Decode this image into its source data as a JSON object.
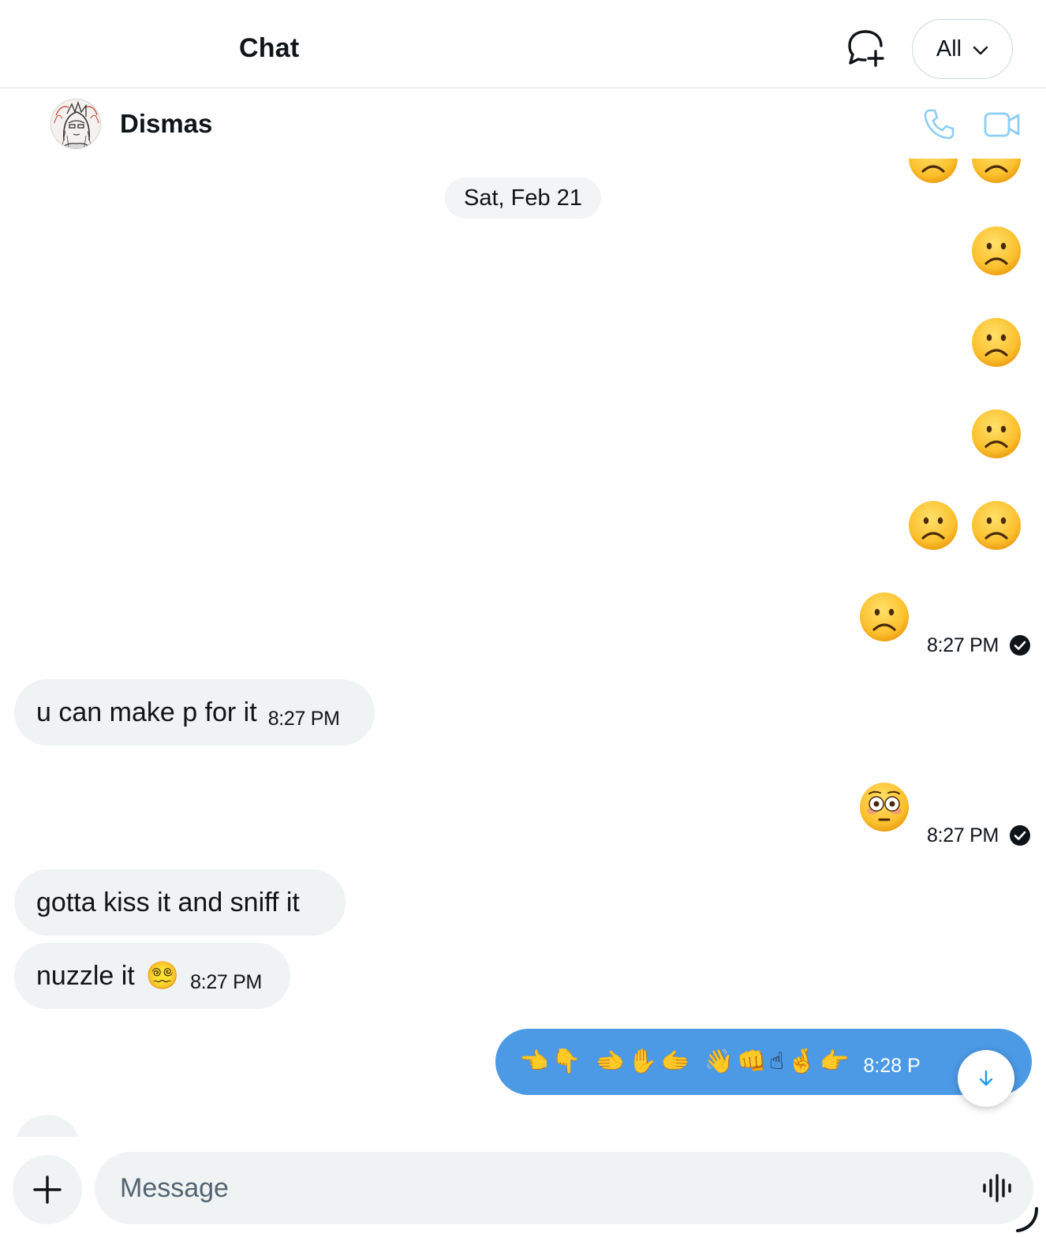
{
  "header": {
    "title": "Chat",
    "filter_label": "All",
    "icons": [
      "new-chat-icon",
      "chevron-down-icon"
    ]
  },
  "conversation": {
    "contact_name": "Dismas",
    "icons": [
      "phone-icon",
      "video-camera-icon"
    ]
  },
  "messages": {
    "date_label": "Sat, Feb 21",
    "outgoing_emoji_1": {
      "emoji": "frowning-face x7",
      "time": "8:27 PM"
    },
    "incoming_1": {
      "text": "u can make p for it",
      "time": "8:27 PM"
    },
    "outgoing_emoji_2": {
      "emoji": "flushed-face",
      "time": "8:27 PM"
    },
    "incoming_2": {
      "text": "gotta kiss it and sniff it"
    },
    "incoming_3": {
      "text": "nuzzle it",
      "emoji": "😵‍💫",
      "time": "8:27 PM"
    },
    "outgoing_hands": {
      "emoji": [
        "👈",
        "👇",
        "🫲",
        "✋",
        "🫱",
        "👋",
        "👊",
        "☝",
        "🤞",
        "👉"
      ],
      "time": "8:28 P"
    }
  },
  "composer": {
    "placeholder": "Message",
    "icons": [
      "plus-icon",
      "voice-waveform-icon"
    ]
  },
  "colors": {
    "accent": "#1d9bf0",
    "outgoing_bubble": "#4c9ae6",
    "incoming_bubble": "#eff3f4",
    "emoji_yellow": "#fbc02d"
  }
}
